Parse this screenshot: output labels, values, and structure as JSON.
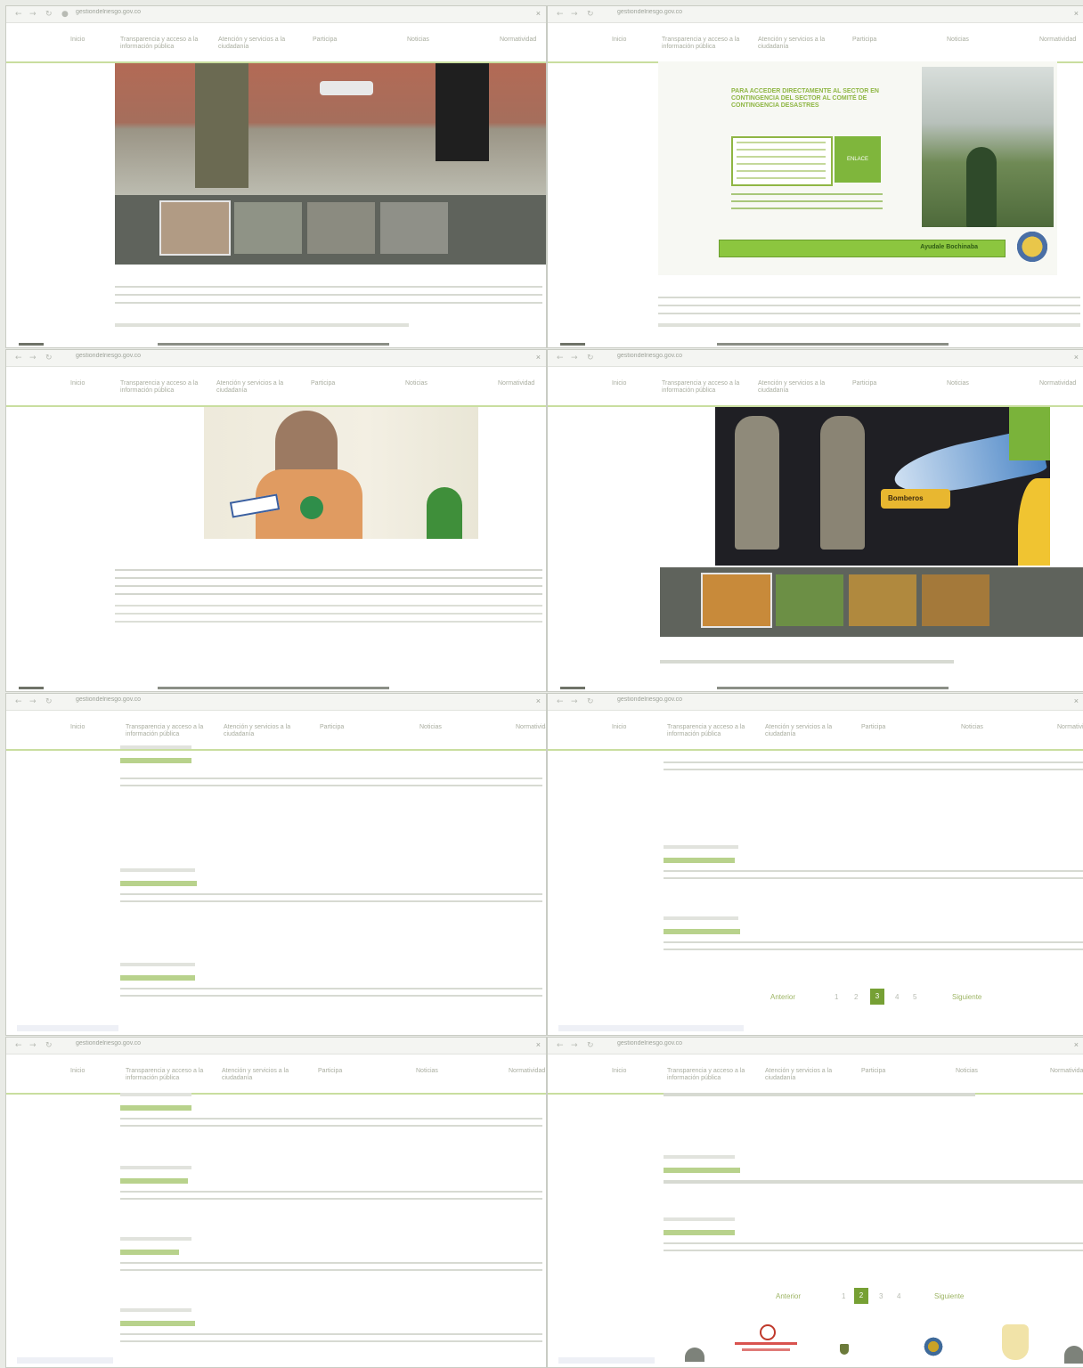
{
  "browser": {
    "url_1": "gestiondelriesgo.gov.co",
    "url_2": "gestiondelriesgo.gov.co",
    "url_3": "gestiondelriesgo.gov.co",
    "url_4": "gestiondelriesgo.gov.co",
    "url_5": "gestiondelriesgo.gov.co",
    "url_6": "gestiondelriesgo.gov.co",
    "url_7": "gestiondelriesgo.gov.co",
    "url_8": "gestiondelriesgo.gov.co"
  },
  "menu": {
    "home": "Inicio",
    "item_1": "Transparencia y acceso a la información pública",
    "item_2": "Atención y servicios a la ciudadanía",
    "item_3": "Participa",
    "item_4": "Noticias",
    "item_5": "Normatividad"
  },
  "panel_2": {
    "green_box_title": "PARA ACCEDER DIRECTAMENTE AL SECTOR EN CONTINGENCIA DEL SECTOR AL COMITÉ DE CONTINGENCIA DESASTRES",
    "side_button": "ENLACE",
    "banner": "Ayudale Bochinaba"
  },
  "panel_4": {
    "logo_text": "Bomberos"
  },
  "pagination": {
    "prev": "Anterior",
    "next": "Siguiente",
    "pages_6": [
      "1",
      "2",
      "3",
      "4",
      "5"
    ],
    "selected_6": "3",
    "pages_8": [
      "1",
      "2",
      "3",
      "4"
    ],
    "selected_8": "2"
  },
  "colors": {
    "accent_green": "#76a034",
    "light_green": "#c9de9f",
    "title_green": "#a5c46b",
    "dark_gray": "#5f635c"
  }
}
